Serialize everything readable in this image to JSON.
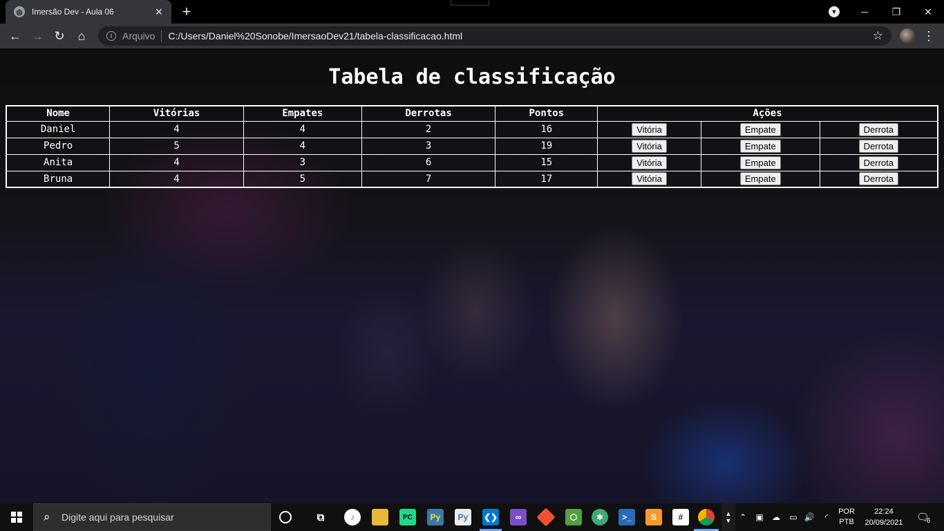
{
  "browser": {
    "tab_title": "Imersão Dev - Aula 06",
    "tab_close": "✕",
    "new_tab": "+",
    "protocol_label": "Arquivo",
    "url": "C:/Users/Daniel%20Sonobe/ImersaoDev21/tabela-classificacao.html"
  },
  "page": {
    "title": "Tabela de classificação",
    "headers": [
      "Nome",
      "Vitórias",
      "Empates",
      "Derrotas",
      "Pontos",
      "Ações"
    ],
    "rows": [
      {
        "nome": "Daniel",
        "vitorias": "4",
        "empates": "4",
        "derrotas": "2",
        "pontos": "16"
      },
      {
        "nome": "Pedro",
        "vitorias": "5",
        "empates": "4",
        "derrotas": "3",
        "pontos": "19"
      },
      {
        "nome": "Anita",
        "vitorias": "4",
        "empates": "3",
        "derrotas": "6",
        "pontos": "15"
      },
      {
        "nome": "Bruna",
        "vitorias": "4",
        "empates": "5",
        "derrotas": "7",
        "pontos": "17"
      }
    ],
    "buttons": {
      "vitoria": "Vitória",
      "empate": "Empate",
      "derrota": "Derrota"
    }
  },
  "taskbar": {
    "search_placeholder": "Digite aqui para pesquisar",
    "language_top": "POR",
    "language_bottom": "PTB",
    "time": "22:24",
    "date": "20/09/2021",
    "notification_count": "6",
    "apps": [
      "cortana-icon",
      "task-view-icon",
      "itunes-icon",
      "file-explorer-icon",
      "pycharm-icon",
      "python-icon",
      "python-idle-icon",
      "vscode-icon",
      "visual-studio-icon",
      "git-icon",
      "nodejs-icon",
      "atom-icon",
      "powershell-icon",
      "sublime-text-icon",
      "slack-icon",
      "chrome-icon"
    ]
  },
  "colors": {
    "chrome_bg": "#35363a",
    "omnibox_bg": "#202124",
    "taskbar_bg": "#101010",
    "table_border": "#ffffff",
    "text": "#ffffff"
  }
}
